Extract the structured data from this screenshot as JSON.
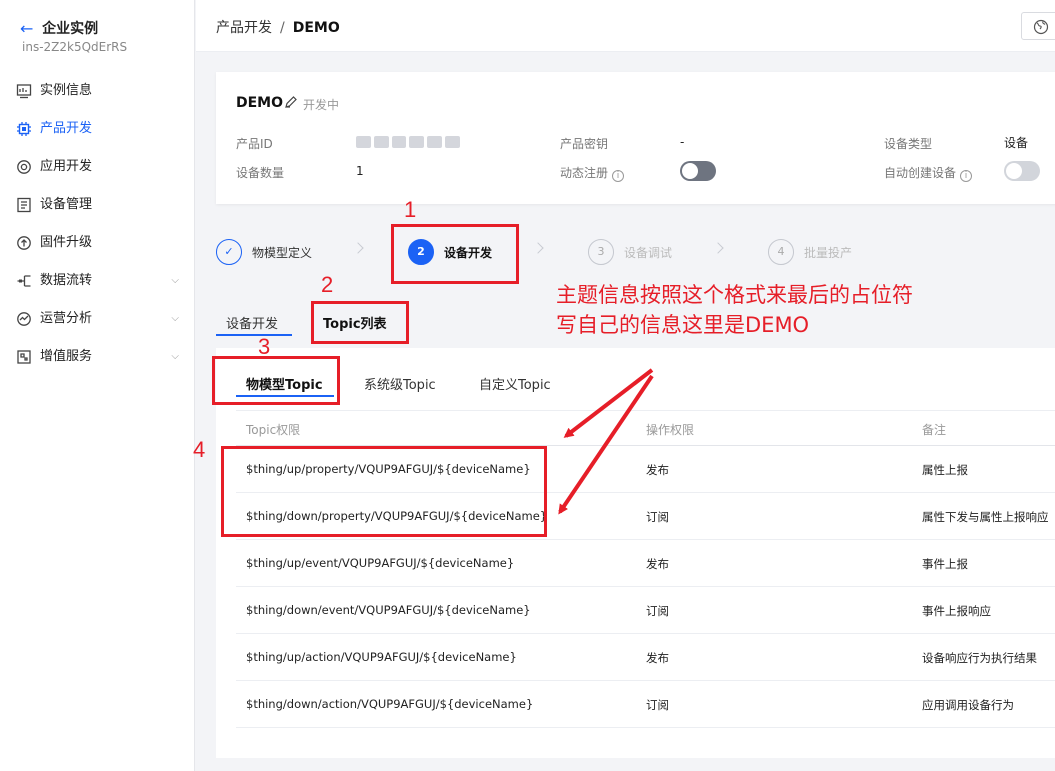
{
  "sidebar": {
    "title": "企业实例",
    "instance_id": "ins-2Z2k5QdErRS",
    "items": [
      {
        "label": "实例信息",
        "icon": "monitor-icon"
      },
      {
        "label": "产品开发",
        "icon": "chip-icon",
        "active": true
      },
      {
        "label": "应用开发",
        "icon": "target-icon"
      },
      {
        "label": "设备管理",
        "icon": "list-icon"
      },
      {
        "label": "固件升级",
        "icon": "upgrade-icon"
      },
      {
        "label": "数据流转",
        "icon": "flow-icon",
        "expandable": true
      },
      {
        "label": "运营分析",
        "icon": "chart-icon",
        "expandable": true
      },
      {
        "label": "增值服务",
        "icon": "service-icon",
        "expandable": true
      }
    ]
  },
  "header": {
    "breadcrumb_parent": "产品开发",
    "breadcrumb_sep": "/",
    "breadcrumb_current": "DEMO"
  },
  "product": {
    "name": "DEMO",
    "status": "开发中",
    "id_label": "产品ID",
    "secret_label": "产品密钥",
    "secret_value": "-",
    "type_label": "设备类型",
    "type_value": "设备",
    "count_label": "设备数量",
    "count_value": "1",
    "dynamic_reg_label": "动态注册",
    "auto_create_label": "自动创建设备"
  },
  "steps": [
    {
      "num": "✓",
      "label": "物模型定义",
      "state": "done"
    },
    {
      "num": "2",
      "label": "设备开发",
      "state": "active"
    },
    {
      "num": "3",
      "label": "设备调试",
      "state": "pending"
    },
    {
      "num": "4",
      "label": "批量投产",
      "state": "pending"
    }
  ],
  "subtabs": {
    "dev": "设备开发",
    "topic_list": "Topic列表"
  },
  "topic_tabs": {
    "model": "物模型Topic",
    "system": "系统级Topic",
    "custom": "自定义Topic"
  },
  "table": {
    "headers": {
      "topic": "Topic权限",
      "perm": "操作权限",
      "remark": "备注"
    },
    "rows": [
      {
        "topic": "$thing/up/property/VQUP9AFGUJ/${deviceName}",
        "perm": "发布",
        "remark": "属性上报"
      },
      {
        "topic": "$thing/down/property/VQUP9AFGUJ/${deviceName}",
        "perm": "订阅",
        "remark": "属性下发与属性上报响应"
      },
      {
        "topic": "$thing/up/event/VQUP9AFGUJ/${deviceName}",
        "perm": "发布",
        "remark": "事件上报"
      },
      {
        "topic": "$thing/down/event/VQUP9AFGUJ/${deviceName}",
        "perm": "订阅",
        "remark": "事件上报响应"
      },
      {
        "topic": "$thing/up/action/VQUP9AFGUJ/${deviceName}",
        "perm": "发布",
        "remark": "设备响应行为执行结果"
      },
      {
        "topic": "$thing/down/action/VQUP9AFGUJ/${deviceName}",
        "perm": "订阅",
        "remark": "应用调用设备行为"
      }
    ]
  },
  "annotations": {
    "n1": "1",
    "n2": "2",
    "n3": "3",
    "n4": "4",
    "note_line1": "主题信息按照这个格式来最后的占位符",
    "note_line2": "写自己的信息这里是DEMO"
  },
  "colors": {
    "accent": "#1b62f5",
    "annotation": "#e61e28"
  }
}
